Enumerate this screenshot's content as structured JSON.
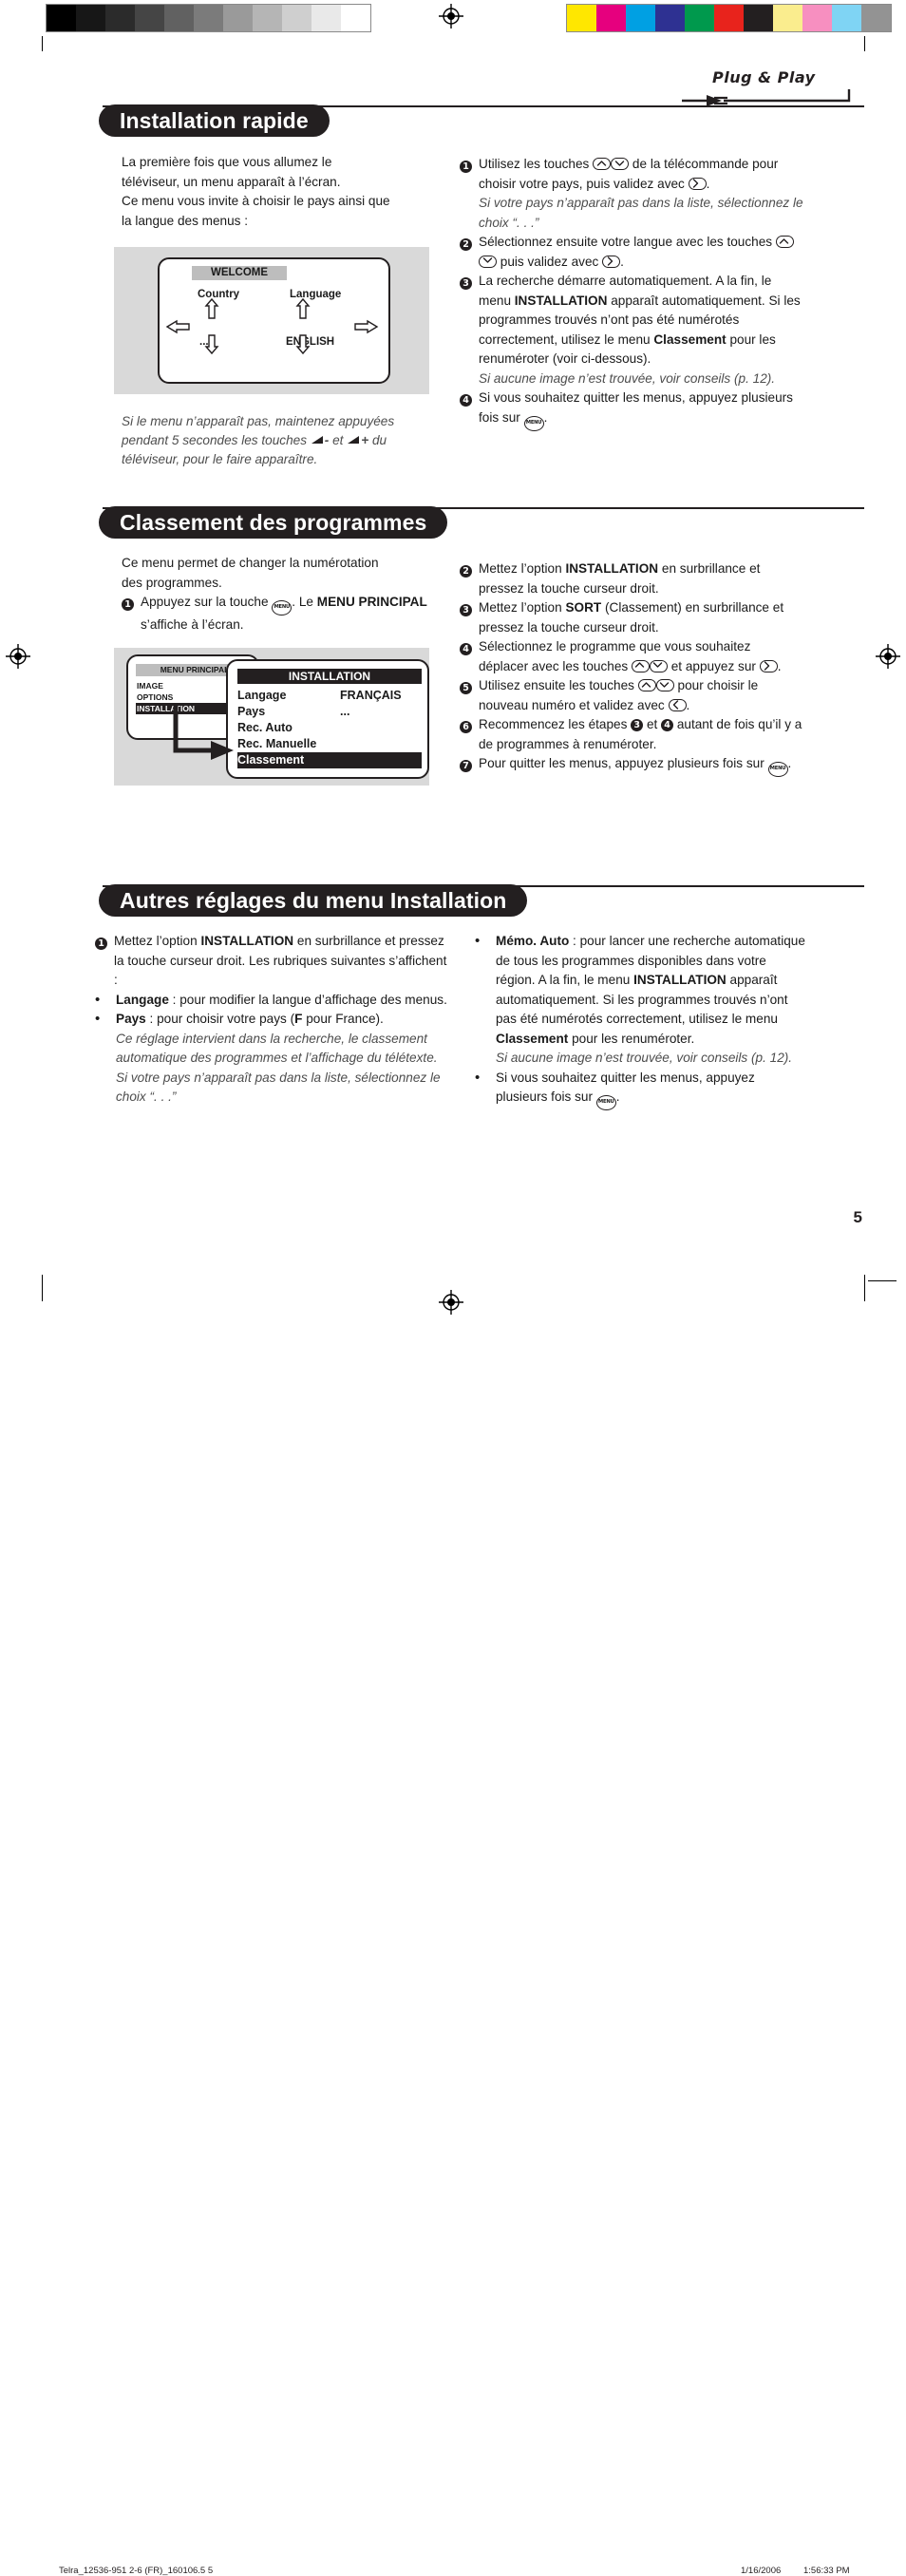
{
  "print_marks": {
    "gray_bar": [
      "#000000",
      "#171717",
      "#2b2b2b",
      "#454545",
      "#616161",
      "#7b7b7b",
      "#9a9a9a",
      "#b5b5b5",
      "#cfcfcf",
      "#e9e9e9",
      "#ffffff"
    ],
    "color_bar": [
      "#ffe700",
      "#e6007e",
      "#00a0e3",
      "#2e3192",
      "#00994d",
      "#e8231c",
      "#231f20",
      "#faed8e",
      "#f78fc0",
      "#7fd4f4",
      "#939393"
    ]
  },
  "logo": {
    "text": "Plug & Play"
  },
  "sections": [
    {
      "id": "installation-rapide",
      "title": "Installation rapide",
      "left": {
        "intro": [
          "La première fois que vous allumez le",
          "téléviseur, un menu apparaît à l’écran.",
          "Ce menu vous invite à choisir le pays ainsi que",
          "la langue des menus :"
        ],
        "note": "Si le menu n’apparaît pas, maintenez appuyées pendant 5 secondes les touches ◢- et ◢+ du téléviseur, pour le faire apparaître.",
        "note_part1": "Si le menu n’apparaît pas, maintenez appuyées pendant 5 secondes les touches",
        "note_vol_minus": "-",
        "note_et": "et",
        "note_vol_plus": "+",
        "note_part2": "du téléviseur, pour le faire apparaître.",
        "figure": {
          "title": "WELCOME",
          "country_label": "Country",
          "country_value": "...",
          "language_label": "Language",
          "language_value": "ENGLISH"
        }
      },
      "right_steps": [
        {
          "num": "1",
          "runs": [
            {
              "t": "Utilisez les touches ",
              "s": "n"
            },
            {
              "t": "KEY_UP",
              "s": "key"
            },
            {
              "t": "KEY_DOWN",
              "s": "key"
            },
            {
              "t": " de la télécommande pour choisir votre pays, puis validez avec ",
              "s": "n"
            },
            {
              "t": "KEY_RIGHT",
              "s": "key"
            },
            {
              "t": ".",
              "s": "n"
            }
          ],
          "italic": "Si votre pays n’apparaît pas dans la liste, sélectionnez le choix “. . .”"
        },
        {
          "num": "2",
          "runs": [
            {
              "t": "Sélectionnez ensuite votre langue avec les touches ",
              "s": "n"
            },
            {
              "t": "KEY_UP",
              "s": "key"
            },
            {
              "t": "KEY_DOWN",
              "s": "key"
            },
            {
              "t": " puis validez avec ",
              "s": "n"
            },
            {
              "t": "KEY_RIGHT",
              "s": "key"
            },
            {
              "t": ".",
              "s": "n"
            }
          ],
          "italic": ""
        },
        {
          "num": "3",
          "runs": [
            {
              "t": "La recherche démarre automatiquement. A la fin, le menu ",
              "s": "n"
            },
            {
              "t": "INSTALLATION",
              "s": "b"
            },
            {
              "t": " apparaît automatiquement. Si les programmes trouvés n’ont pas été numérotés correctement, utilisez le menu ",
              "s": "n"
            },
            {
              "t": "Classement",
              "s": "b"
            },
            {
              "t": " pour les renuméroter (voir ci-dessous).",
              "s": "n"
            }
          ],
          "italic": "Si aucune image n’est trouvée, voir conseils (p. 12)."
        },
        {
          "num": "4",
          "runs": [
            {
              "t": "Si vous souhaitez quitter les menus, appuyez plusieurs fois sur ",
              "s": "n"
            },
            {
              "t": "KEY_MENU",
              "s": "key"
            },
            {
              "t": ".",
              "s": "n"
            }
          ],
          "italic": ""
        }
      ]
    },
    {
      "id": "classement-des-programmes",
      "title": "Classement des programmes",
      "left": {
        "intro": [
          "Ce menu permet de changer la numérotation",
          "des programmes."
        ],
        "step1": {
          "num": "1",
          "runs": [
            {
              "t": "Appuyez sur la touche ",
              "s": "n"
            },
            {
              "t": "KEY_MENU",
              "s": "key"
            },
            {
              "t": ". Le ",
              "s": "n"
            },
            {
              "t": "MENU PRINCIPAL",
              "s": "b"
            },
            {
              "t": " s’affiche à l’écran.",
              "s": "n"
            }
          ]
        },
        "figure": {
          "main_menu_title": "MENU PRINCIPAL",
          "main_menu_items": [
            "IMAGE",
            "OPTIONS",
            "INSTALLATION"
          ],
          "main_menu_selected": "INSTALLATION",
          "install_title": "INSTALLATION",
          "install_rows": [
            {
              "label": "Langage",
              "value": "FRANÇAIS",
              "selected": false
            },
            {
              "label": "Pays",
              "value": "...",
              "selected": false
            },
            {
              "label": "Rec. Auto",
              "value": "",
              "selected": false
            },
            {
              "label": "Rec. Manuelle",
              "value": "",
              "selected": false
            },
            {
              "label": "Classement",
              "value": "",
              "selected": true
            }
          ]
        }
      },
      "right_steps": [
        {
          "num": "2",
          "runs": [
            {
              "t": "Mettez l’option ",
              "s": "n"
            },
            {
              "t": "INSTALLATION",
              "s": "b"
            },
            {
              "t": " en surbrillance et pressez la touche curseur droit.",
              "s": "n"
            }
          ],
          "italic": ""
        },
        {
          "num": "3",
          "runs": [
            {
              "t": "Mettez l’option ",
              "s": "n"
            },
            {
              "t": "SORT",
              "s": "b"
            },
            {
              "t": " (Classement) en surbrillance et pressez la touche curseur droit.",
              "s": "n"
            }
          ],
          "italic": ""
        },
        {
          "num": "4",
          "runs": [
            {
              "t": "Sélectionnez le programme que vous souhaitez déplacer avec les touches ",
              "s": "n"
            },
            {
              "t": "KEY_UP",
              "s": "key"
            },
            {
              "t": "KEY_DOWN",
              "s": "key"
            },
            {
              "t": " et appuyez sur ",
              "s": "n"
            },
            {
              "t": "KEY_RIGHT",
              "s": "key"
            },
            {
              "t": ".",
              "s": "n"
            }
          ],
          "italic": ""
        },
        {
          "num": "5",
          "runs": [
            {
              "t": "Utilisez ensuite les touches ",
              "s": "n"
            },
            {
              "t": "KEY_UP",
              "s": "key"
            },
            {
              "t": "KEY_DOWN",
              "s": "key"
            },
            {
              "t": " pour choisir le nouveau numéro et validez avec ",
              "s": "n"
            },
            {
              "t": "KEY_LEFT",
              "s": "key"
            },
            {
              "t": ".",
              "s": "n"
            }
          ],
          "italic": ""
        },
        {
          "num": "6",
          "runs": [
            {
              "t": "Recommencez les étapes ",
              "s": "n"
            },
            {
              "t": "3",
              "s": "cir"
            },
            {
              "t": " et ",
              "s": "n"
            },
            {
              "t": "4",
              "s": "cir"
            },
            {
              "t": " autant de fois qu’il y a de programmes à renuméroter.",
              "s": "n"
            }
          ],
          "italic": ""
        },
        {
          "num": "7",
          "runs": [
            {
              "t": "Pour quitter les menus, appuyez plusieurs fois sur ",
              "s": "n"
            },
            {
              "t": "KEY_MENU",
              "s": "key"
            },
            {
              "t": ".",
              "s": "n"
            }
          ],
          "italic": ""
        }
      ]
    },
    {
      "id": "autres-reglages",
      "title": "Autres réglages du menu Installation",
      "left_items": [
        {
          "type": "num",
          "num": "1",
          "runs": [
            {
              "t": "Mettez l’option ",
              "s": "n"
            },
            {
              "t": "INSTALLATION",
              "s": "b"
            },
            {
              "t": " en surbrillance et pressez la touche curseur droit. Les rubriques suivantes s’affichent :",
              "s": "n"
            }
          ],
          "italic": ""
        },
        {
          "type": "bullet",
          "runs": [
            {
              "t": "Langage",
              "s": "b"
            },
            {
              "t": " : pour modifier la langue d’affichage des menus.",
              "s": "n"
            }
          ],
          "italic": ""
        },
        {
          "type": "bullet",
          "runs": [
            {
              "t": "Pays",
              "s": "b"
            },
            {
              "t": " : pour choisir votre pays (",
              "s": "n"
            },
            {
              "t": "F",
              "s": "b"
            },
            {
              "t": " pour France).",
              "s": "n"
            }
          ],
          "italic": "Ce réglage intervient dans la recherche, le classement automatique des programmes et l’affichage du télétexte. Si votre pays n’apparaît pas dans la liste, sélectionnez le choix “. . .”"
        }
      ],
      "right_items": [
        {
          "type": "bullet",
          "runs": [
            {
              "t": "Mémo. Auto",
              "s": "b"
            },
            {
              "t": " : pour lancer une recherche automatique de tous les programmes disponibles dans votre région. A la fin, le menu ",
              "s": "n"
            },
            {
              "t": "INSTALLATION",
              "s": "b"
            },
            {
              "t": " apparaît automatiquement. Si les programmes trouvés n’ont pas été numérotés correctement, utilisez le menu ",
              "s": "n"
            },
            {
              "t": "Classement",
              "s": "b"
            },
            {
              "t": " pour les renuméroter.",
              "s": "n"
            }
          ],
          "italic": "Si aucune image n’est trouvée, voir conseils (p. 12)."
        },
        {
          "type": "bullet",
          "runs": [
            {
              "t": "Si vous souhaitez quitter les menus, appuyez plusieurs fois sur ",
              "s": "n"
            },
            {
              "t": "KEY_MENU",
              "s": "key"
            },
            {
              "t": ".",
              "s": "n"
            }
          ],
          "italic": ""
        }
      ]
    }
  ],
  "page_number": "5",
  "footer": {
    "file": "Telra_12536-951 2-6 (FR)_160106.5   5",
    "date": "1/16/2006",
    "time": "1:56:33 PM"
  }
}
